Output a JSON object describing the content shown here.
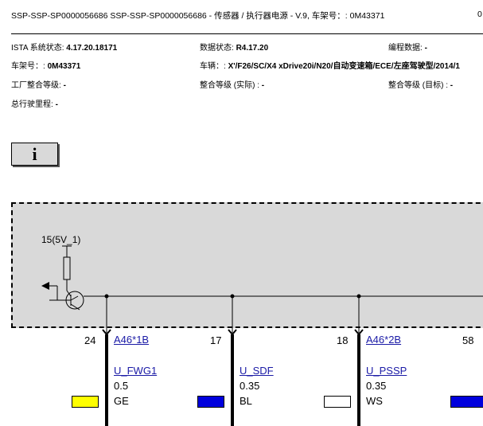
{
  "header": {
    "title": "SSP-SSP-SP0000056686 SSP-SSP-SP0000056686 - 传感器 / 执行器电源 - V.9, 车架号：: 0M43371",
    "right_fragment": "0"
  },
  "info": {
    "ista_label": "ISTA 系统状态: ",
    "ista_value": "4.17.20.18171",
    "data_label": "数据状态: ",
    "data_value": "R4.17.20",
    "prog_label": "编程数据: ",
    "prog_value": "-",
    "vin_label": "车架号：: ",
    "vin_value": "0M43371",
    "vehicle_label": "车辆：: ",
    "vehicle_value": "X'/F26/SC/X4 xDrive20i/N20/自动变速箱/ECE/左座驾驶型/2014/1",
    "factory_label": "工厂整合等级: ",
    "factory_value": "-",
    "actual_label": "整合等级 (实际) : ",
    "actual_value": "-",
    "target_label": "整合等级 (目标) : ",
    "target_value": "-",
    "mileage_label": "总行驶里程: ",
    "mileage_value": "-"
  },
  "info_icon": "info-icon",
  "diagram": {
    "supply_label": "15(5V_1)",
    "pins": [
      {
        "number": "24",
        "connector": "A46*1B",
        "signal": "U_FWG1",
        "cross_section": "0.5",
        "color_code": "GE",
        "color_hex": "#ffff00"
      },
      {
        "number": "17",
        "connector": "",
        "signal": "U_SDF",
        "cross_section": "0.35",
        "color_code": "BL",
        "color_hex": "#0000dd"
      },
      {
        "number": "18",
        "connector": "A46*2B",
        "signal": "U_PSSP",
        "cross_section": "0.35",
        "color_code": "WS",
        "color_hex": "#ffffff"
      },
      {
        "number": "58",
        "connector": "",
        "signal": "",
        "cross_section": "",
        "color_code": "",
        "color_hex": "#0000dd"
      }
    ]
  }
}
